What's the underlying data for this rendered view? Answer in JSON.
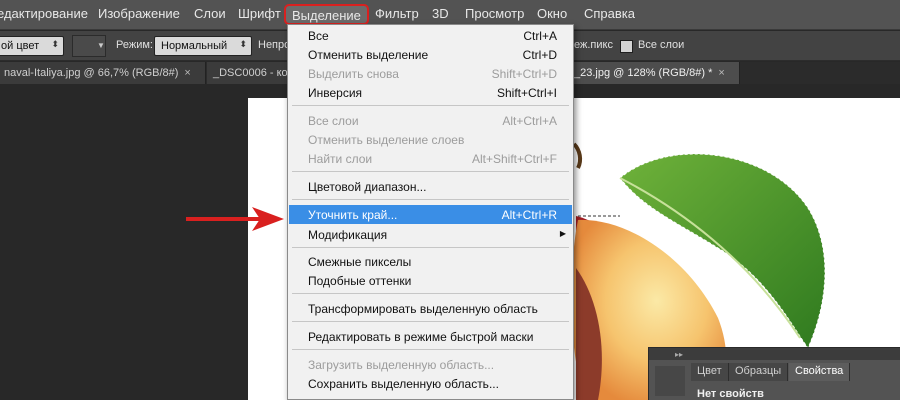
{
  "menubar": {
    "items": [
      "едактирование",
      "Изображение",
      "Слои",
      "Шрифт",
      "Выделение",
      "Фильтр",
      "3D",
      "Просмотр",
      "Окно",
      "Справка"
    ]
  },
  "options": {
    "color_mode": "ой цвет",
    "mode_label": "Режим:",
    "mode_value": "Нормальный",
    "opacity_label": "Непроз",
    "adjacent_label": "еж.пикс",
    "all_layers_label": "Все слои"
  },
  "tabs": [
    {
      "label": "naval-Italiya.jpg @ 66,7% (RGB/8#)",
      "close": "×"
    },
    {
      "label": "_DSC0006 - ко",
      "close": ""
    },
    {
      "label": "_23.jpg @ 128% (RGB/8#) *",
      "close": "×"
    }
  ],
  "menu": [
    {
      "label": "Все",
      "shortcut": "Ctrl+A",
      "state": "enabled"
    },
    {
      "label": "Отменить выделение",
      "shortcut": "Ctrl+D",
      "state": "enabled"
    },
    {
      "label": "Выделить снова",
      "shortcut": "Shift+Ctrl+D",
      "state": "disabled"
    },
    {
      "label": "Инверсия",
      "shortcut": "Shift+Ctrl+I",
      "state": "enabled"
    },
    {
      "label": "Все слои",
      "shortcut": "Alt+Ctrl+A",
      "state": "disabled"
    },
    {
      "label": "Отменить выделение слоев",
      "shortcut": "",
      "state": "disabled"
    },
    {
      "label": "Найти слои",
      "shortcut": "Alt+Shift+Ctrl+F",
      "state": "disabled"
    },
    {
      "label": "Цветовой диапазон...",
      "shortcut": "",
      "state": "enabled"
    },
    {
      "label": "Уточнить край...",
      "shortcut": "Alt+Ctrl+R",
      "state": "highlighted"
    },
    {
      "label": "Модификация",
      "shortcut": "",
      "state": "submenu"
    },
    {
      "label": "Смежные пикселы",
      "shortcut": "",
      "state": "enabled"
    },
    {
      "label": "Подобные оттенки",
      "shortcut": "",
      "state": "enabled"
    },
    {
      "label": "Трансформировать выделенную область",
      "shortcut": "",
      "state": "enabled"
    },
    {
      "label": "Редактировать в режиме быстрой маски",
      "shortcut": "",
      "state": "enabled"
    },
    {
      "label": "Загрузить выделенную область...",
      "shortcut": "",
      "state": "disabled"
    },
    {
      "label": "Сохранить выделенную область...",
      "shortcut": "",
      "state": "enabled"
    }
  ],
  "panel": {
    "tabs": [
      "Цвет",
      "Образцы",
      "Свойства"
    ],
    "active_tab": "Свойства",
    "body_text": "Нет свойств"
  },
  "colors": {
    "highlight": "#3a8ee6",
    "annotation_red": "#d9201f"
  }
}
